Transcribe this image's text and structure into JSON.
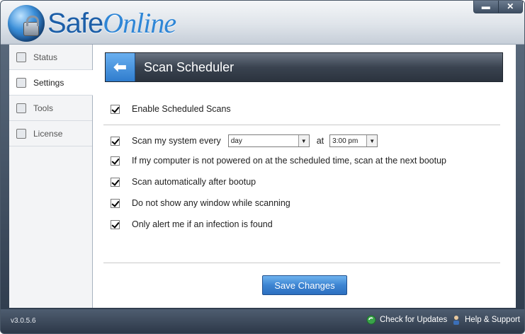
{
  "app": {
    "logo_safe": "Safe",
    "logo_online": "Online",
    "min_glyph": "▬",
    "close_glyph": "✕"
  },
  "sidebar": {
    "items": [
      {
        "label": "Status",
        "icon": "checkmark-icon"
      },
      {
        "label": "Settings",
        "icon": "floppy-disk-icon",
        "active": true
      },
      {
        "label": "Tools",
        "icon": "toolbox-icon"
      },
      {
        "label": "License",
        "icon": "document-icon"
      }
    ]
  },
  "header": {
    "back_glyph": "⬅",
    "title": "Scan Scheduler"
  },
  "options": {
    "enable_scheduled": "Enable Scheduled Scans",
    "scan_every_label": "Scan my system every",
    "frequency_value": "day",
    "at_label": "at",
    "time_value": "3:00 pm",
    "next_bootup": "If my computer is not powered on at the scheduled time, scan at the next bootup",
    "after_bootup": "Scan automatically after bootup",
    "no_window": "Do not show any window while scanning",
    "alert_infection": "Only alert me if an infection is found"
  },
  "actions": {
    "save_label": "Save Changes"
  },
  "footer": {
    "version": "v3.0.5.6",
    "check_updates": "Check for Updates",
    "help_support": "Help & Support"
  },
  "colors": {
    "accent": "#3d85d2",
    "header_dark": "#2b333e",
    "frame": "#2d3a4b"
  }
}
